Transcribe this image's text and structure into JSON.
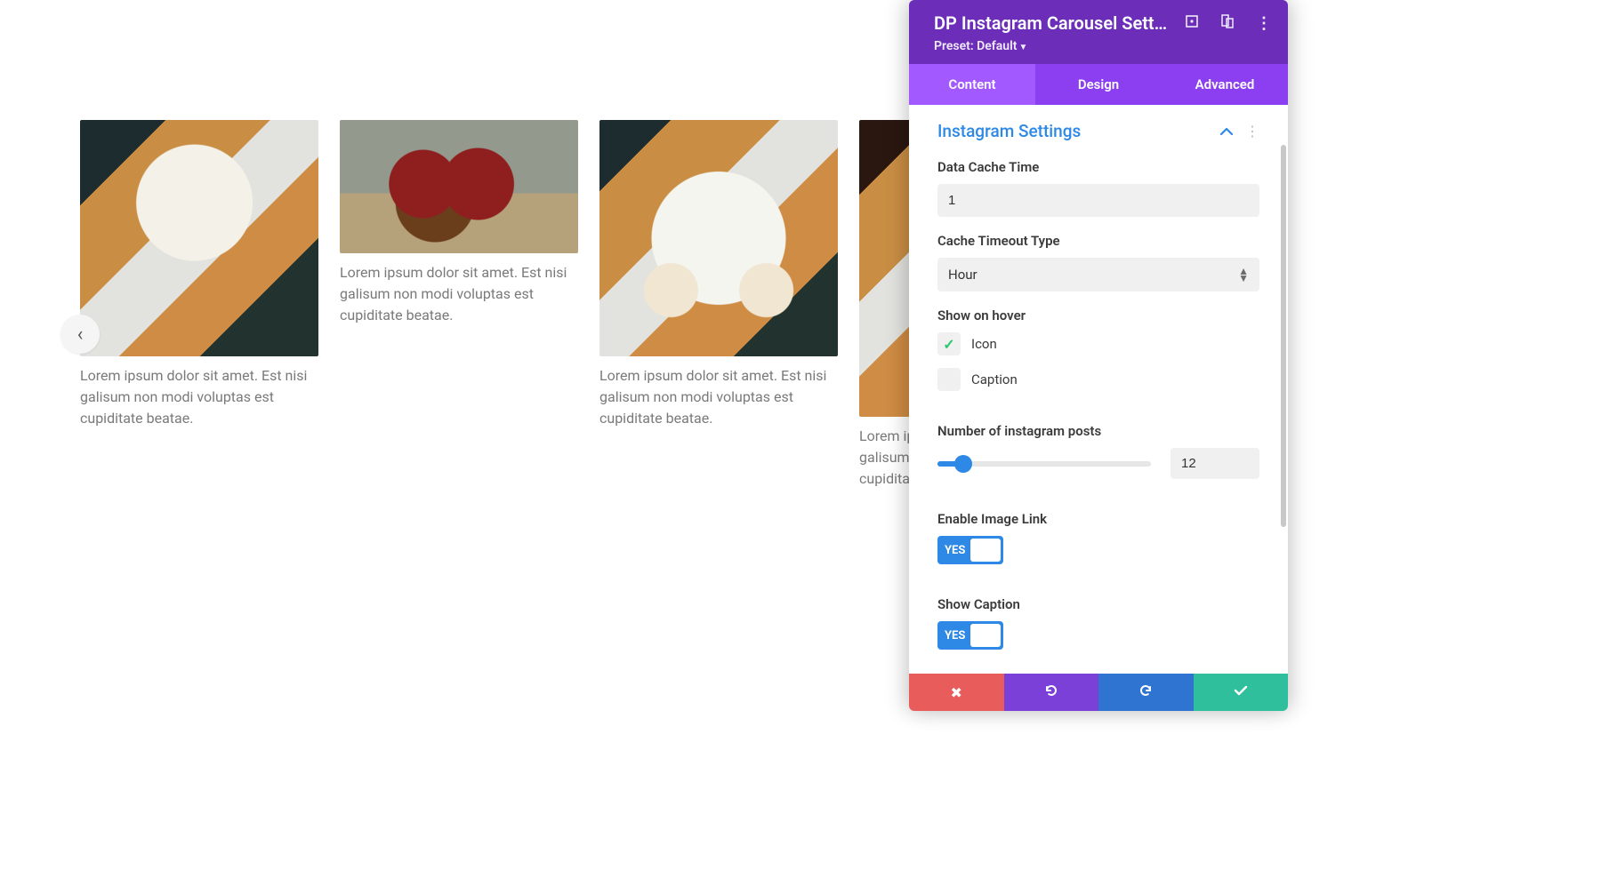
{
  "carousel": {
    "caption": "Lorem ipsum dolor sit amet. Est nisi galisum non modi voluptas est cupiditate beatae.",
    "caption_clipped": "Lorem ips\ngalisum n\ncupiditat"
  },
  "nav_prev_glyph": "‹",
  "panel": {
    "title": "DP Instagram Carousel Sett…",
    "preset_label": "Preset: Default"
  },
  "tabs": {
    "content": "Content",
    "design": "Design",
    "advanced": "Advanced"
  },
  "section": {
    "title": "Instagram Settings"
  },
  "fields": {
    "cache_time_label": "Data Cache Time",
    "cache_time_value": "1",
    "cache_type_label": "Cache Timeout Type",
    "cache_type_value": "Hour",
    "show_hover_label": "Show on hover",
    "icon_label": "Icon",
    "caption_label": "Caption",
    "num_posts_label": "Number of instagram posts",
    "num_posts_value": "12",
    "enable_link_label": "Enable Image Link",
    "show_caption_label": "Show Caption",
    "toggle_yes": "YES"
  },
  "checkmark": "✓",
  "kebab": "⋮",
  "close_glyph": "✖"
}
